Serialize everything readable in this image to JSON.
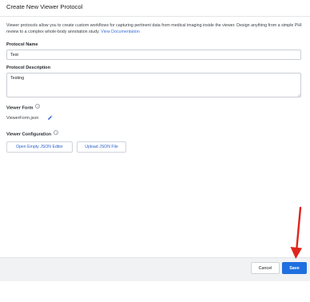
{
  "modal": {
    "title": "Create New Viewer Protocol",
    "intro_text": "Viewer protocols allow you to create custom workflows for capturing pertinent data from medical imaging inside the viewer. Design anything from a simple PHI review to a complex whole-body annotation study.",
    "intro_link": "View Documentation"
  },
  "protocol_name": {
    "label": "Protocol Name",
    "value": "Test"
  },
  "protocol_description": {
    "label": "Protocol Description",
    "value": "Testing"
  },
  "viewer_form": {
    "label": "Viewer Form",
    "file_name": "ViewerForm.json"
  },
  "viewer_configuration": {
    "label": "Viewer Configuration",
    "open_editor_label": "Open Empty JSON Editor",
    "upload_label": "Upload JSON File"
  },
  "footer": {
    "cancel_label": "Cancel",
    "save_label": "Save"
  },
  "icons": {
    "info": "info-icon",
    "edit": "pencil-icon"
  },
  "colors": {
    "primary": "#1f6fe0",
    "link": "#3a6fd8",
    "annotation_arrow": "#e0251b"
  }
}
